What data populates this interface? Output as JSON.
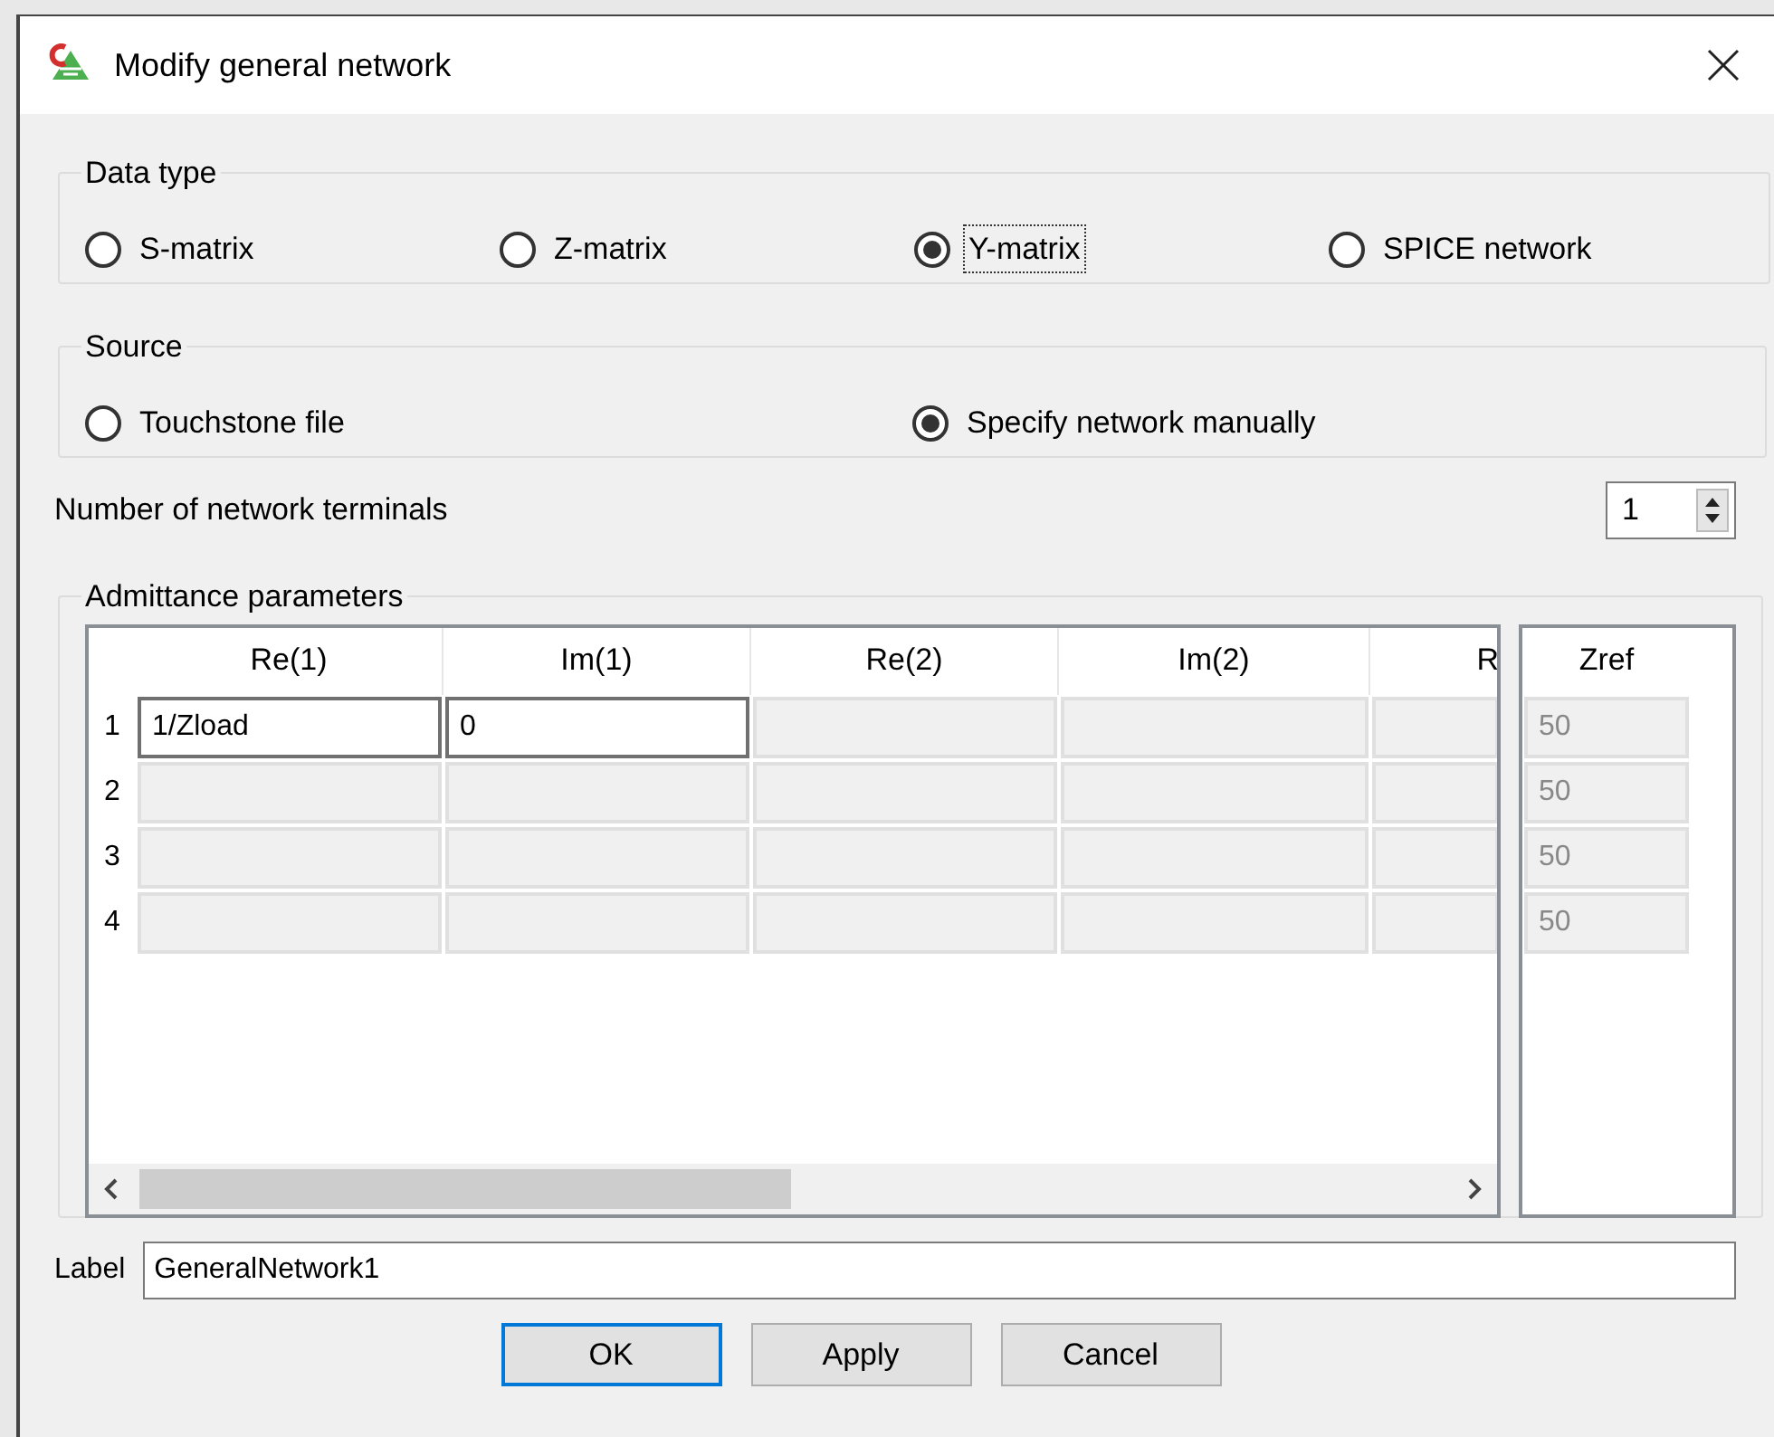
{
  "window": {
    "title": "Modify general network"
  },
  "data_type": {
    "legend": "Data type",
    "options": [
      {
        "label": "S-matrix",
        "selected": false,
        "focused": false
      },
      {
        "label": "Z-matrix",
        "selected": false,
        "focused": false
      },
      {
        "label": "Y-matrix",
        "selected": true,
        "focused": true
      },
      {
        "label": "SPICE network",
        "selected": false,
        "focused": false
      }
    ]
  },
  "source": {
    "legend": "Source",
    "options": [
      {
        "label": "Touchstone file",
        "selected": false
      },
      {
        "label": "Specify network manually",
        "selected": true
      }
    ]
  },
  "terminals": {
    "label": "Number of network terminals",
    "value": "1"
  },
  "parameters": {
    "legend": "Admittance parameters",
    "columns": [
      "Re(1)",
      "Im(1)",
      "Re(2)",
      "Im(2)",
      "R"
    ],
    "rows": [
      {
        "header": "1",
        "cells": [
          {
            "value": "1/Zload",
            "enabled": true
          },
          {
            "value": "0",
            "enabled": true
          },
          {
            "enabled": false
          },
          {
            "enabled": false
          },
          {
            "enabled": false
          }
        ]
      },
      {
        "header": "2",
        "cells": [
          {
            "enabled": false
          },
          {
            "enabled": false
          },
          {
            "enabled": false
          },
          {
            "enabled": false
          },
          {
            "enabled": false
          }
        ]
      },
      {
        "header": "3",
        "cells": [
          {
            "enabled": false
          },
          {
            "enabled": false
          },
          {
            "enabled": false
          },
          {
            "enabled": false
          },
          {
            "enabled": false
          }
        ]
      },
      {
        "header": "4",
        "cells": [
          {
            "enabled": false
          },
          {
            "enabled": false
          },
          {
            "enabled": false
          },
          {
            "enabled": false
          },
          {
            "enabled": false
          }
        ]
      }
    ],
    "zref": {
      "column": "Zref",
      "cells": [
        {
          "value": "50",
          "enabled": false
        },
        {
          "value": "50",
          "enabled": false
        },
        {
          "value": "50",
          "enabled": false
        },
        {
          "value": "50",
          "enabled": false
        }
      ]
    }
  },
  "label_field": {
    "label": "Label",
    "value": "GeneralNetwork1"
  },
  "buttons": [
    {
      "label": "OK",
      "default": true
    },
    {
      "label": "Apply",
      "default": false
    },
    {
      "label": "Cancel",
      "default": false
    }
  ]
}
